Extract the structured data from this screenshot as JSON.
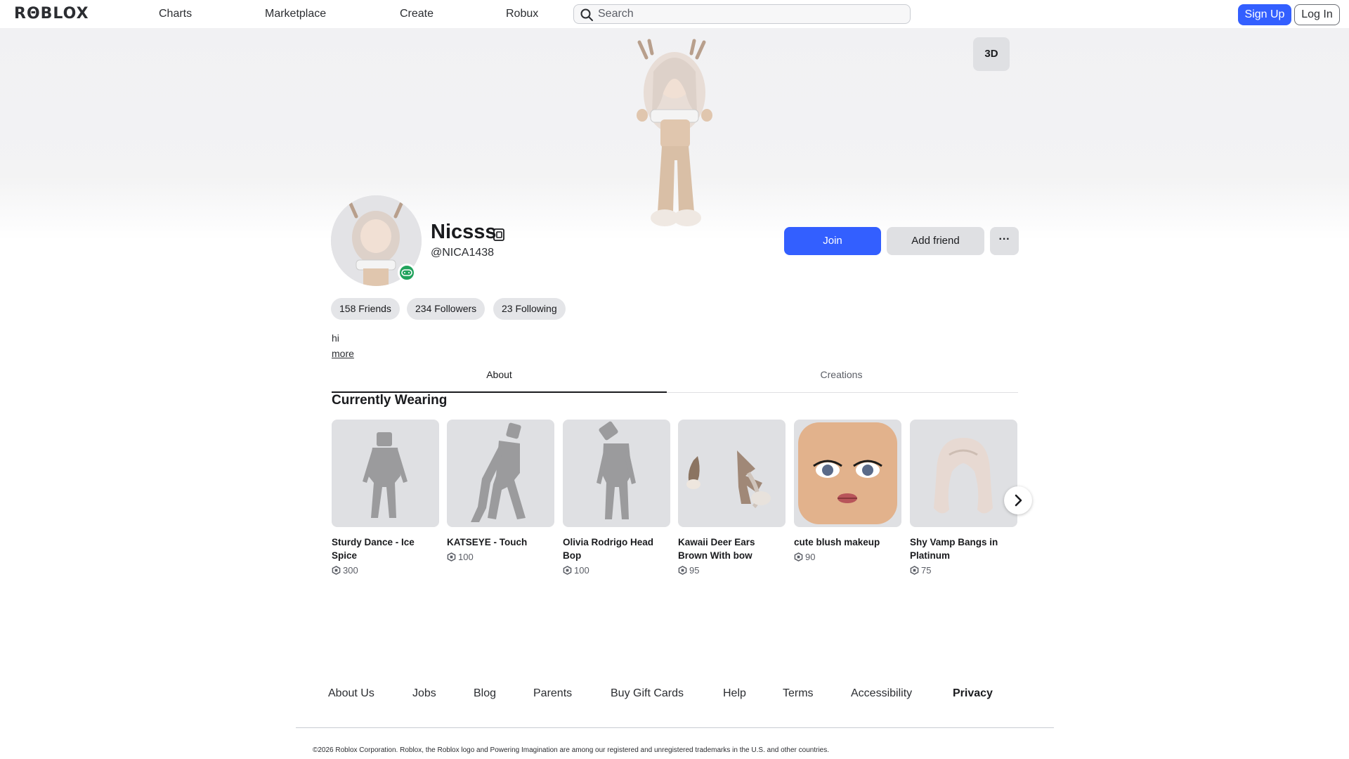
{
  "header": {
    "logo": "RΘBLOX",
    "nav": [
      "Charts",
      "Marketplace",
      "Create",
      "Robux"
    ],
    "search_placeholder": "Search",
    "signup": "Sign Up",
    "login": "Log In"
  },
  "hero": {
    "view_toggle": "3D"
  },
  "profile": {
    "display_name": "Nicsss",
    "username": "@NICA1438",
    "join": "Join",
    "add_friend": "Add friend",
    "more_menu": "···",
    "stats": [
      "158 Friends",
      "234 Followers",
      "23 Following"
    ],
    "bio": "hi",
    "more_link": "more"
  },
  "tabs": [
    "About",
    "Creations"
  ],
  "wearing": {
    "title": "Currently Wearing",
    "items": [
      {
        "name": "Sturdy Dance - Ice Spice",
        "price": "300",
        "icon": "emote-silhouette"
      },
      {
        "name": "KATSEYE - Touch",
        "price": "100",
        "icon": "emote-silhouette"
      },
      {
        "name": "Olivia Rodrigo Head Bop",
        "price": "100",
        "icon": "emote-silhouette"
      },
      {
        "name": "Kawaii Deer Ears Brown With bow",
        "price": "95",
        "icon": "deer-ears"
      },
      {
        "name": "cute blush makeup",
        "price": "90",
        "icon": "face"
      },
      {
        "name": "Shy Vamp Bangs in Platinum",
        "price": "75",
        "icon": "hair"
      }
    ]
  },
  "footer": {
    "links": [
      "About Us",
      "Jobs",
      "Blog",
      "Parents",
      "Buy Gift Cards",
      "Help",
      "Terms",
      "Accessibility",
      "Privacy"
    ],
    "copyright": "©2026 Roblox Corporation. Roblox, the Roblox logo and Powering Imagination are among our registered and unregistered trademarks in the U.S. and other countries."
  },
  "colors": {
    "primary": "#335fff",
    "online": "#21a35c",
    "surface": "#dfe0e3"
  }
}
